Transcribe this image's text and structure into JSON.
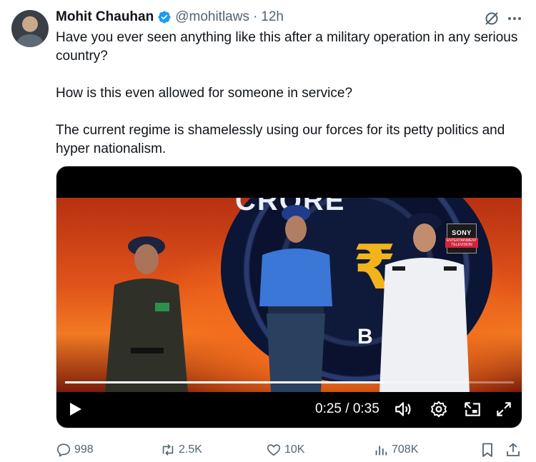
{
  "tweet": {
    "author_name": "Mohit Chauhan",
    "handle": "@mohitlaws",
    "separator": "·",
    "time": "12h",
    "paragraphs": [
      "Have you ever seen anything like this after a military operation in any serious country?",
      "How is this even allowed for someone in service?",
      "The current regime is shamelessly using our forces for its petty politics and hyper nationalism."
    ]
  },
  "video": {
    "broadcaster_logo_top": "SONY",
    "broadcaster_logo_bottom": "ENTERTAINMENT TELEVISION",
    "wheel_letter": "B",
    "timecode": "0:25 / 0:35",
    "progress": 0.71
  },
  "actions": {
    "replies": "998",
    "reposts": "2.5K",
    "likes": "10K",
    "views": "708K"
  },
  "colors": {
    "text_primary": "#0f1419",
    "text_secondary": "#536471",
    "verified_blue": "#1d9bf0"
  },
  "icons": [
    "verified-badge-icon",
    "grok-icon",
    "more-icon",
    "play-icon",
    "volume-icon",
    "settings-icon",
    "picture-in-picture-icon",
    "fullscreen-icon",
    "reply-icon",
    "repost-icon",
    "like-icon",
    "views-icon",
    "bookmark-icon",
    "share-icon"
  ]
}
